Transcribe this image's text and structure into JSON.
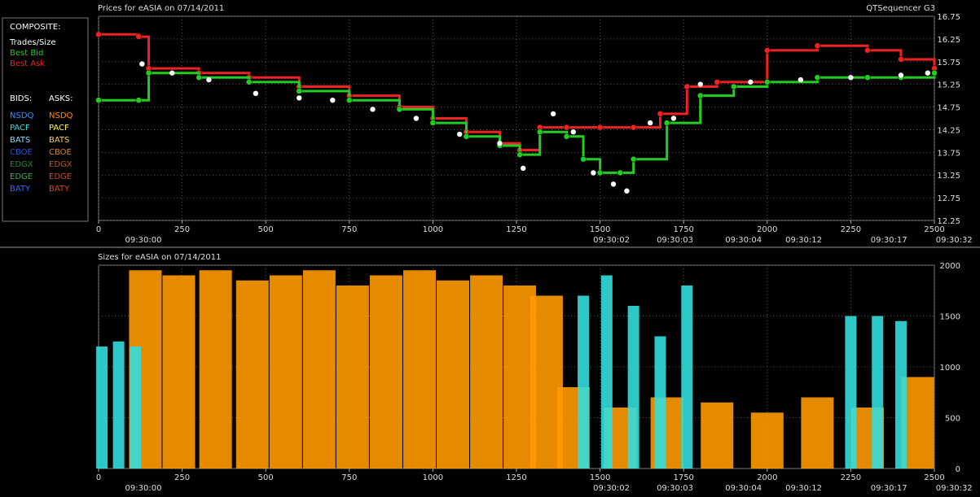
{
  "app_title": "QTSequencer G3",
  "legend": {
    "composite_title": "COMPOSITE:",
    "composite_items": [
      {
        "label": "Trades/Size",
        "color": "#ffffff"
      },
      {
        "label": "Best Bid",
        "color": "#22cc22"
      },
      {
        "label": "Best Ask",
        "color": "#ee2222"
      }
    ],
    "bids_header": "BIDS:",
    "asks_header": "ASKS:",
    "exchanges": [
      {
        "bid": "NSDQ",
        "ask": "NSDQ",
        "bid_color": "#3a8cff",
        "ask_color": "#ff8c00"
      },
      {
        "bid": "PACF",
        "ask": "PACF",
        "bid_color": "#33dddd",
        "ask_color": "#ffff33"
      },
      {
        "bid": "BATS",
        "ask": "BATS",
        "bid_color": "#88ddff",
        "ask_color": "#ffcc55"
      },
      {
        "bid": "CBOE",
        "ask": "CBOE",
        "bid_color": "#2255cc",
        "ask_color": "#cc8833"
      },
      {
        "bid": "EDGX",
        "ask": "EDGX",
        "bid_color": "#228822",
        "ask_color": "#bb5522"
      },
      {
        "bid": "EDGE",
        "ask": "EDGE",
        "bid_color": "#44aa44",
        "ask_color": "#cc4422"
      },
      {
        "bid": "BATY",
        "ask": "BATY",
        "bid_color": "#3366ff",
        "ask_color": "#dd4422"
      }
    ]
  },
  "x_ticks": [
    "0",
    "250",
    "500",
    "750",
    "1000",
    "1250",
    "1500",
    "1750",
    "2000",
    "2250",
    "2500"
  ],
  "time_labels": [
    {
      "x": 0,
      "label": "09:30:00"
    },
    {
      "x": 1400,
      "label": "09:30:02"
    },
    {
      "x": 1590,
      "label": "09:30:03"
    },
    {
      "x": 1795,
      "label": "09:30:04"
    },
    {
      "x": 1975,
      "label": "09:30:12"
    },
    {
      "x": 2230,
      "label": "09:30:17"
    },
    {
      "x": 2425,
      "label": "09:30:32"
    }
  ],
  "chart_data": [
    {
      "type": "line",
      "title": "Prices for  eASIA  on  07/14/2011",
      "xlim": [
        0,
        2500
      ],
      "ylim": [
        12.25,
        16.75
      ],
      "y_ticks": [
        "16.75",
        "16.25",
        "15.75",
        "15.25",
        "14.75",
        "14.25",
        "13.75",
        "13.25",
        "12.75",
        "12.25"
      ],
      "grid": true,
      "series": [
        {
          "name": "Best Ask",
          "color": "#ee2222",
          "x": [
            0,
            120,
            150,
            300,
            450,
            600,
            750,
            900,
            1000,
            1100,
            1200,
            1260,
            1320,
            1400,
            1500,
            1600,
            1680,
            1760,
            1850,
            2000,
            2150,
            2300,
            2400,
            2500
          ],
          "values": [
            16.35,
            16.3,
            15.6,
            15.5,
            15.4,
            15.2,
            15.0,
            14.75,
            14.5,
            14.2,
            13.95,
            13.8,
            14.3,
            14.3,
            14.3,
            14.3,
            14.6,
            15.2,
            15.3,
            16.0,
            16.1,
            16.0,
            15.8,
            15.6
          ]
        },
        {
          "name": "Best Bid",
          "color": "#22cc22",
          "x": [
            0,
            120,
            150,
            300,
            450,
            600,
            750,
            900,
            1000,
            1100,
            1200,
            1260,
            1320,
            1400,
            1450,
            1500,
            1560,
            1600,
            1700,
            1800,
            1900,
            2000,
            2150,
            2300,
            2400,
            2500
          ],
          "values": [
            14.9,
            14.9,
            15.5,
            15.4,
            15.3,
            15.1,
            14.9,
            14.7,
            14.4,
            14.1,
            13.9,
            13.7,
            14.2,
            14.1,
            13.6,
            13.3,
            13.3,
            13.6,
            14.4,
            15.0,
            15.2,
            15.3,
            15.4,
            15.4,
            15.4,
            15.5
          ]
        },
        {
          "name": "Trades/Size",
          "color": "#ffffff",
          "x": [
            130,
            220,
            330,
            470,
            600,
            700,
            820,
            950,
            1080,
            1200,
            1270,
            1360,
            1420,
            1480,
            1540,
            1580,
            1650,
            1720,
            1800,
            1950,
            2100,
            2250,
            2400,
            2480
          ],
          "values": [
            15.7,
            15.5,
            15.35,
            15.05,
            14.95,
            14.9,
            14.7,
            14.5,
            14.15,
            13.95,
            13.4,
            14.6,
            14.2,
            13.3,
            13.05,
            12.9,
            14.4,
            14.5,
            15.25,
            15.3,
            15.35,
            15.4,
            15.45,
            15.5
          ]
        }
      ]
    },
    {
      "type": "bar",
      "title": "Sizes for  eASIA  on  07/14/2011",
      "xlim": [
        0,
        2500
      ],
      "ylim": [
        0,
        2000
      ],
      "y_ticks": [
        "2000",
        "1500",
        "1000",
        "500",
        "0"
      ],
      "grid": true,
      "series": [
        {
          "name": "NSDQ asks",
          "color": "#ff9900",
          "x": [
            140,
            240,
            350,
            460,
            560,
            660,
            760,
            860,
            960,
            1060,
            1160,
            1260,
            1340,
            1420,
            1560,
            1700,
            1850,
            2000,
            2150,
            2300,
            2450
          ],
          "values": [
            1950,
            1900,
            1950,
            1850,
            1900,
            1950,
            1800,
            1900,
            1950,
            1850,
            1900,
            1800,
            1700,
            800,
            600,
            700,
            650,
            550,
            700,
            600,
            900
          ]
        },
        {
          "name": "PACF bids",
          "color": "#33dddd",
          "x": [
            10,
            60,
            110,
            1450,
            1520,
            1600,
            1680,
            1760,
            2250,
            2330,
            2400
          ],
          "values": [
            1200,
            1250,
            1200,
            1700,
            1900,
            1600,
            1300,
            1800,
            1500,
            1500,
            1450
          ]
        }
      ]
    }
  ]
}
